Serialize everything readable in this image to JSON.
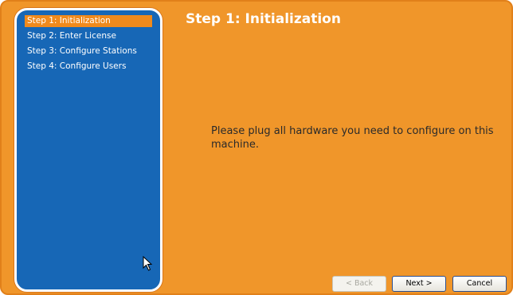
{
  "sidebar": {
    "steps": [
      {
        "label": "Step 1: Initialization",
        "active": true
      },
      {
        "label": "Step 2: Enter License",
        "active": false
      },
      {
        "label": "Step 3: Configure Stations",
        "active": false
      },
      {
        "label": "Step 4: Configure Users",
        "active": false
      }
    ]
  },
  "main": {
    "title": "Step 1: Initialization",
    "message": "Please plug all hardware you need to configure on this machine."
  },
  "buttons": {
    "back": "< Back",
    "next": "Next >",
    "cancel": "Cancel"
  },
  "colors": {
    "background": "#f0962a",
    "sidebar": "#1767b6",
    "active_step": "#f08a1c"
  },
  "icons": [
    "mouse-pointer-icon"
  ]
}
